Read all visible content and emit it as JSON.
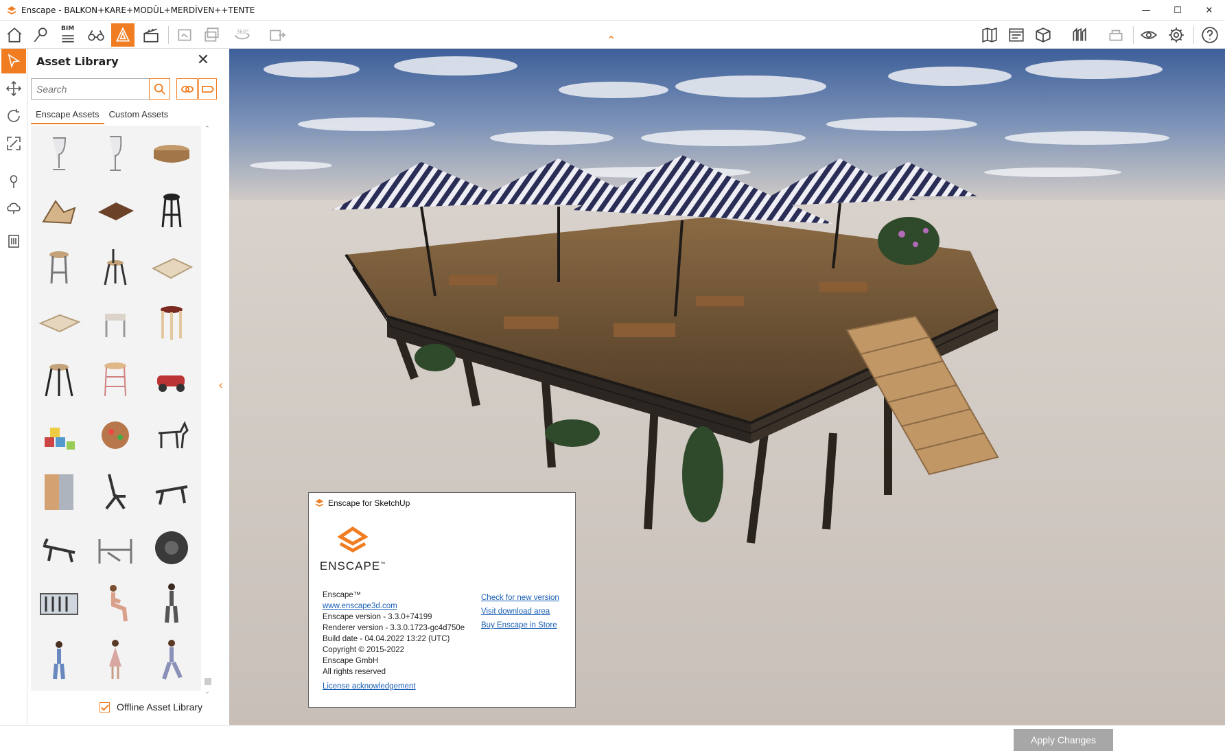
{
  "window": {
    "title": "Enscape - BALKON+KARE+MODÜL+MERDİVEN++TENTE"
  },
  "toolbar": {
    "bim_label": "BIM"
  },
  "panel": {
    "title": "Asset Library",
    "search_placeholder": "Search",
    "tabs": [
      "Enscape Assets",
      "Custom Assets"
    ],
    "offline_label": "Offline Asset Library",
    "offline_checked": true
  },
  "assets": [
    "wine-glass",
    "wine-glass-tall",
    "wooden-bowl",
    "lounge-chair",
    "wooden-board",
    "bar-stool-black",
    "bar-stool-wood",
    "bar-stool-metal",
    "wooden-pallet",
    "wooden-pallet-flat",
    "small-stool",
    "round-stool",
    "tripod-stool",
    "wire-stool",
    "toy-car",
    "toy-blocks",
    "toy-clock",
    "toy-zebra",
    "wardrobe",
    "weight-bench-incline",
    "weight-bench-flat",
    "weight-bench-decline",
    "weight-rack",
    "tire",
    "wall-art",
    "person-woman-sitting",
    "person-woman-standing",
    "person-child",
    "person-woman-dress",
    "person-woman-walking"
  ],
  "about": {
    "header": "Enscape for SketchUp",
    "logo_word": "ENSCAPE",
    "logo_tm": "™",
    "product": "Enscape™",
    "website": "www.enscape3d.com",
    "version": "Enscape version - 3.3.0+74199",
    "renderer": "Renderer version - 3.3.0.1723-gc4d750e",
    "build_date": "Build date - 04.04.2022 13:22 (UTC)",
    "copyright": "Copyright © 2015-2022",
    "company": "Enscape GmbH",
    "rights": "All rights reserved",
    "links": [
      "Check for new version",
      "Visit download area",
      "Buy Enscape in Store"
    ],
    "license": "License acknowledgement"
  },
  "statusbar": {
    "apply_label": "Apply Changes"
  },
  "colors": {
    "accent": "#f07d22",
    "link": "#1a5fb4",
    "apply_button": "#a7a7a7"
  }
}
